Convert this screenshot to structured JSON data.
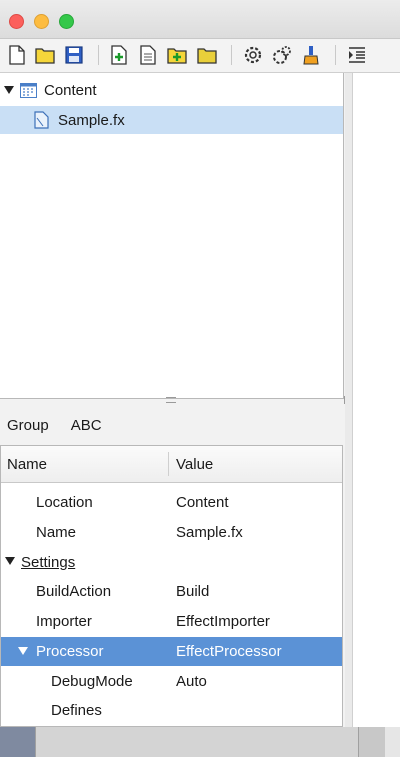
{
  "window": {
    "controls": [
      "close",
      "minimize",
      "zoom"
    ]
  },
  "toolbar": {
    "buttons": [
      "new-file-icon",
      "open-folder-icon",
      "save-icon",
      "add-new-item-icon",
      "add-existing-item-icon",
      "add-folder-icon",
      "folder-icon",
      "build-icon",
      "rebuild-icon",
      "clean-icon",
      "filter-output-icon"
    ]
  },
  "tree": {
    "items": [
      {
        "label": "Content",
        "icon": "content-project-icon",
        "expanded": true,
        "selected": false
      },
      {
        "label": "Sample.fx",
        "icon": "file-icon",
        "selected": true
      }
    ]
  },
  "property_grid": {
    "group_by": {
      "group_label": "Group",
      "abc_label": "ABC"
    },
    "columns": {
      "name": "Name",
      "value": "Value"
    },
    "rows": [
      {
        "name": "Location",
        "value": "Content",
        "level": 1
      },
      {
        "name": "Name",
        "value": "Sample.fx",
        "level": 1
      },
      {
        "name": "Settings",
        "value": "",
        "level": 0,
        "category": true
      },
      {
        "name": "BuildAction",
        "value": "Build",
        "level": 1
      },
      {
        "name": "Importer",
        "value": "EffectImporter",
        "level": 1
      },
      {
        "name": "Processor",
        "value": "EffectProcessor",
        "level": 1,
        "expanded": true,
        "selected": true
      },
      {
        "name": "DebugMode",
        "value": "Auto",
        "level": 2
      },
      {
        "name": "Defines",
        "value": "",
        "level": 2
      }
    ]
  },
  "colors": {
    "tree_selection": "#c9dff5",
    "grid_selection": "#5b92d6"
  }
}
